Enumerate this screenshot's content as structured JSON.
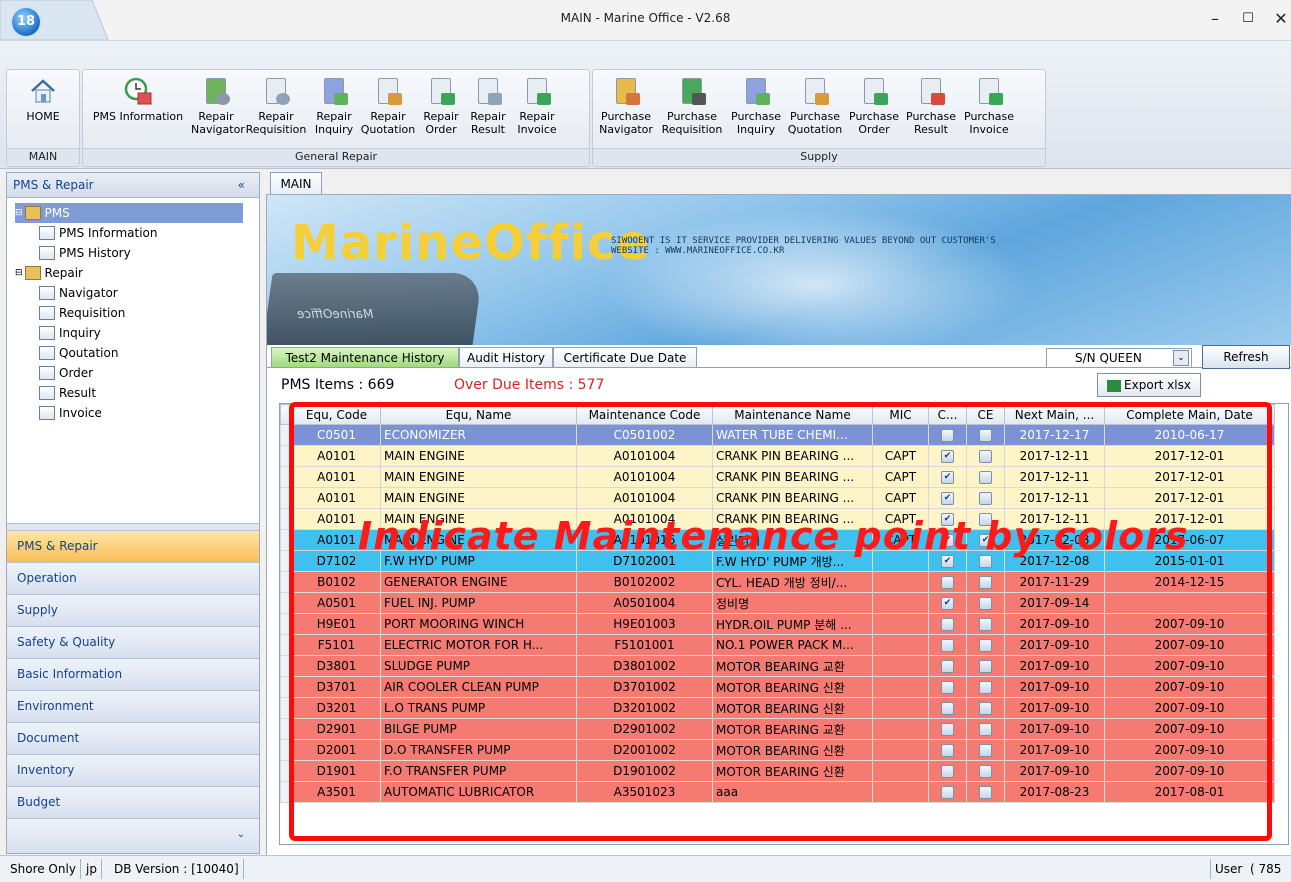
{
  "window": {
    "title": "MAIN - Marine Office - V2.68",
    "min": "–",
    "max": "☐",
    "close": "✕"
  },
  "ribbon": {
    "home_group": {
      "label": "MAIN",
      "buttons": [
        {
          "label": "HOME"
        }
      ]
    },
    "pms_button": {
      "label": "PMS Information"
    },
    "general_repair": {
      "label": "General Repair",
      "buttons": [
        {
          "label": "Repair Navigator"
        },
        {
          "label": "Repair Requisition"
        },
        {
          "label": "Repair Inquiry"
        },
        {
          "label": "Repair Quotation"
        },
        {
          "label": "Repair Order"
        },
        {
          "label": "Repair Result"
        },
        {
          "label": "Repair Invoice"
        }
      ]
    },
    "supply": {
      "label": "Supply",
      "buttons": [
        {
          "label": "Purchase Navigator"
        },
        {
          "label": "Purchase Requisition"
        },
        {
          "label": "Purchase Inquiry"
        },
        {
          "label": "Purchase Quotation"
        },
        {
          "label": "Purchase Order"
        },
        {
          "label": "Purchase Result"
        },
        {
          "label": "Purchase Invoice"
        }
      ]
    }
  },
  "sidebar": {
    "header": "PMS & Repair",
    "tree": [
      {
        "label": "PMS",
        "level": 0,
        "selected": true
      },
      {
        "label": "PMS Information",
        "level": 1
      },
      {
        "label": "PMS History",
        "level": 1
      },
      {
        "label": "Repair",
        "level": 0
      },
      {
        "label": "Navigator",
        "level": 1
      },
      {
        "label": "Requisition",
        "level": 1
      },
      {
        "label": "Inquiry",
        "level": 1
      },
      {
        "label": "Qoutation",
        "level": 1
      },
      {
        "label": "Order",
        "level": 1
      },
      {
        "label": "Result",
        "level": 1
      },
      {
        "label": "Invoice",
        "level": 1
      }
    ],
    "nav": [
      "PMS & Repair",
      "Operation",
      "Supply",
      "Safety & Quality",
      "Basic Information",
      "Environment",
      "Document",
      "Inventory",
      "Budget"
    ]
  },
  "main": {
    "tab": "MAIN",
    "banner": {
      "logo": "MarineOffice",
      "text_line1": "SIWOOENT IS IT SERVICE PROVIDER DELIVERING VALUES BEYOND OUT CUSTOMER'S",
      "text_line2": "WEBSITE : WWW.MARINEOFFICE.CO.KR",
      "ship_label": "MarineOffice"
    },
    "subtabs": [
      "Test2 Maintenance History",
      "Audit History",
      "Certificate Due Date"
    ],
    "vessel_select": "S/N QUEEN",
    "refresh_label": "Refresh",
    "pms_items_label": "PMS Items :",
    "pms_items_value": "669",
    "overdue_label": "Over Due Items :",
    "overdue_value": "577",
    "export_label": "Export xlsx",
    "annotation": "Indicate Maintenance point by colors"
  },
  "grid": {
    "columns": [
      "Equ, Code",
      "Equ, Name",
      "Maintenance Code",
      "Maintenance Name",
      "MIC",
      "C...",
      "CE",
      "Next Main, ...",
      "Complete Main, Date"
    ],
    "rows": [
      {
        "code": "C0501",
        "name": "ECONOMIZER",
        "mcode": "C0501002",
        "mname": "WATER TUBE CHEMI...",
        "mic": "",
        "c": false,
        "ce": false,
        "next": "2017-12-17",
        "complete": "2010-06-17",
        "color": "#7b93d6"
      },
      {
        "code": "A0101",
        "name": "MAIN ENGINE",
        "mcode": "A0101004",
        "mname": "CRANK PIN BEARING ...",
        "mic": "CAPT",
        "c": true,
        "ce": false,
        "next": "2017-12-11",
        "complete": "2017-12-01",
        "color": "#fdf4c8"
      },
      {
        "code": "A0101",
        "name": "MAIN ENGINE",
        "mcode": "A0101004",
        "mname": "CRANK PIN BEARING ...",
        "mic": "CAPT",
        "c": true,
        "ce": false,
        "next": "2017-12-11",
        "complete": "2017-12-01",
        "color": "#fdf4c8"
      },
      {
        "code": "A0101",
        "name": "MAIN ENGINE",
        "mcode": "A0101004",
        "mname": "CRANK PIN BEARING ...",
        "mic": "CAPT",
        "c": true,
        "ce": false,
        "next": "2017-12-11",
        "complete": "2017-12-01",
        "color": "#fdf4c8"
      },
      {
        "code": "A0101",
        "name": "MAIN ENGINE",
        "mcode": "A0101004",
        "mname": "CRANK PIN BEARING ...",
        "mic": "CAPT",
        "c": true,
        "ce": false,
        "next": "2017-12-11",
        "complete": "2017-12-01",
        "color": "#fdf4c8"
      },
      {
        "code": "A0101",
        "name": "MAIN ENGINE",
        "mcode": "A0101016",
        "mname": "실린더시",
        "mic": "CAPT",
        "c": true,
        "ce": true,
        "next": "2017-12-08",
        "complete": "2017-06-07",
        "color": "#3fc0ee"
      },
      {
        "code": "D7102",
        "name": "F.W HYD' PUMP",
        "mcode": "D7102001",
        "mname": "F.W HYD' PUMP 개방...",
        "mic": "",
        "c": true,
        "ce": false,
        "next": "2017-12-08",
        "complete": "2015-01-01",
        "color": "#3fc0ee"
      },
      {
        "code": "B0102",
        "name": "GENERATOR ENGINE",
        "mcode": "B0102002",
        "mname": "CYL. HEAD 개방 정비/...",
        "mic": "",
        "c": false,
        "ce": false,
        "next": "2017-11-29",
        "complete": "2014-12-15",
        "color": "#f47a72"
      },
      {
        "code": "A0501",
        "name": "FUEL INJ. PUMP",
        "mcode": "A0501004",
        "mname": "정비명",
        "mic": "",
        "c": true,
        "ce": false,
        "next": "2017-09-14",
        "complete": "",
        "color": "#f47a72"
      },
      {
        "code": "H9E01",
        "name": "PORT MOORING WINCH",
        "mcode": "H9E01003",
        "mname": "HYDR.OIL PUMP 분해 ...",
        "mic": "",
        "c": false,
        "ce": false,
        "next": "2017-09-10",
        "complete": "2007-09-10",
        "color": "#f47a72"
      },
      {
        "code": "F5101",
        "name": "ELECTRIC MOTOR FOR H...",
        "mcode": "F5101001",
        "mname": "NO.1 POWER PACK M...",
        "mic": "",
        "c": false,
        "ce": false,
        "next": "2017-09-10",
        "complete": "2007-09-10",
        "color": "#f47a72"
      },
      {
        "code": "D3801",
        "name": "SLUDGE PUMP",
        "mcode": "D3801002",
        "mname": "MOTOR BEARING 교환",
        "mic": "",
        "c": false,
        "ce": false,
        "next": "2017-09-10",
        "complete": "2007-09-10",
        "color": "#f47a72"
      },
      {
        "code": "D3701",
        "name": "AIR COOLER CLEAN PUMP",
        "mcode": "D3701002",
        "mname": "MOTOR BEARING 신환",
        "mic": "",
        "c": false,
        "ce": false,
        "next": "2017-09-10",
        "complete": "2007-09-10",
        "color": "#f47a72"
      },
      {
        "code": "D3201",
        "name": "L.O TRANS PUMP",
        "mcode": "D3201002",
        "mname": "MOTOR BEARING 신환",
        "mic": "",
        "c": false,
        "ce": false,
        "next": "2017-09-10",
        "complete": "2007-09-10",
        "color": "#f47a72"
      },
      {
        "code": "D2901",
        "name": "BILGE PUMP",
        "mcode": "D2901002",
        "mname": "MOTOR BEARING 교환",
        "mic": "",
        "c": false,
        "ce": false,
        "next": "2017-09-10",
        "complete": "2007-09-10",
        "color": "#f47a72"
      },
      {
        "code": "D2001",
        "name": "D.O TRANSFER PUMP",
        "mcode": "D2001002",
        "mname": "MOTOR BEARING 신환",
        "mic": "",
        "c": false,
        "ce": false,
        "next": "2017-09-10",
        "complete": "2007-09-10",
        "color": "#f47a72"
      },
      {
        "code": "D1901",
        "name": "F.O TRANSFER PUMP",
        "mcode": "D1901002",
        "mname": "MOTOR BEARING 신환",
        "mic": "",
        "c": false,
        "ce": false,
        "next": "2017-09-10",
        "complete": "2007-09-10",
        "color": "#f47a72"
      },
      {
        "code": "A3501",
        "name": "AUTOMATIC LUBRICATOR",
        "mcode": "A3501023",
        "mname": "aaa",
        "mic": "",
        "c": false,
        "ce": false,
        "next": "2017-08-23",
        "complete": "2017-08-01",
        "color": "#f47a72"
      }
    ]
  },
  "statusbar": {
    "mode": "Shore Only",
    "lang": "jp",
    "db_version": "DB Version : [10040]",
    "user": "User",
    "user_extra": "( 785"
  }
}
